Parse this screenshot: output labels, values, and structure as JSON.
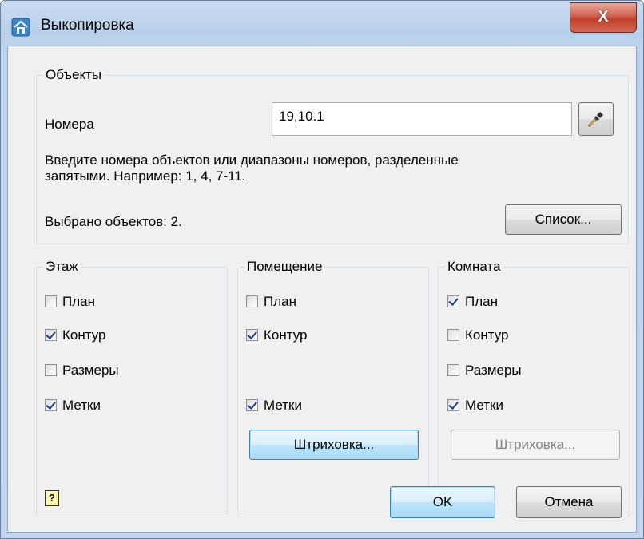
{
  "window": {
    "title": "Выкопировка",
    "close_glyph": "X",
    "icon": "house-icon"
  },
  "objects": {
    "legend": "Объекты",
    "numbers_label": "Номера",
    "numbers_value": "19,10.1",
    "picker_icon": "eyedropper-icon",
    "hint_line1": "Введите номера объектов или диапазоны номеров, разделенные",
    "hint_line2": "запятыми. Например: 1, 4, 7-11.",
    "selected_text": "Выбрано объектов: 2.",
    "list_button": "Список..."
  },
  "floor": {
    "legend": "Этаж",
    "plan": "План",
    "contour": "Контур",
    "dimensions": "Размеры",
    "marks": "Метки",
    "checked": {
      "plan": false,
      "contour": true,
      "dimensions": false,
      "marks": true
    }
  },
  "premises": {
    "legend": "Помещение",
    "plan": "План",
    "contour": "Контур",
    "marks": "Метки",
    "hatch_button": "Штриховка...",
    "checked": {
      "plan": false,
      "contour": true,
      "marks": true
    }
  },
  "room": {
    "legend": "Комната",
    "plan": "План",
    "contour": "Контур",
    "dimensions": "Размеры",
    "marks": "Метки",
    "hatch_button": "Штриховка...",
    "checked": {
      "plan": true,
      "contour": false,
      "dimensions": false,
      "marks": true
    }
  },
  "footer": {
    "help_icon": "help-icon",
    "help_glyph": "?",
    "ok_button": "OK",
    "cancel_button": "Отмена"
  }
}
